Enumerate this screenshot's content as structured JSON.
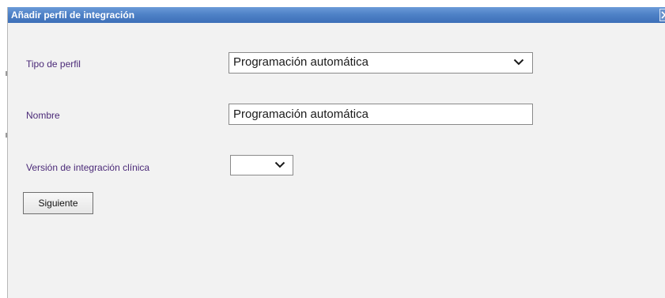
{
  "dialog": {
    "title": "Añadir perfil de integración",
    "close_icon": "close-icon"
  },
  "form": {
    "profile_type": {
      "label": "Tipo de perfil",
      "selected": "Programación automática",
      "icon": "chevron-down-icon"
    },
    "name": {
      "label": "Nombre",
      "value": "Programación automática"
    },
    "clinical_integration_version": {
      "label": "Versión de integración clínica",
      "selected": "",
      "icon": "chevron-down-icon"
    },
    "next_button": "Siguiente"
  },
  "colors": {
    "titlebar": "#4f82c7",
    "label_text": "#4b2a78",
    "dialog_bg": "#f2f2f2"
  }
}
